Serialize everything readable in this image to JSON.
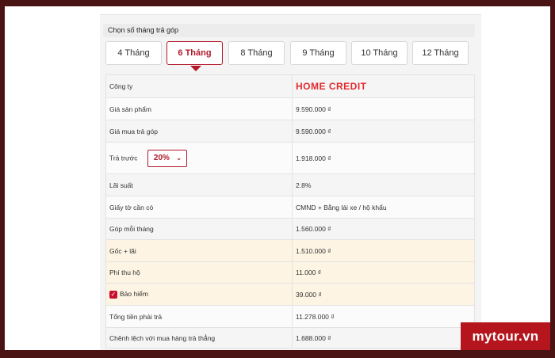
{
  "section_title": "Chọn số tháng trả góp",
  "tabs": [
    {
      "label": "4 Tháng",
      "active": false
    },
    {
      "label": "6 Tháng",
      "active": true
    },
    {
      "label": "8 Tháng",
      "active": false
    },
    {
      "label": "9 Tháng",
      "active": false
    },
    {
      "label": "10 Tháng",
      "active": false
    },
    {
      "label": "12 Tháng",
      "active": false
    }
  ],
  "rows": {
    "company": {
      "label": "Công ty",
      "value": "HOME CREDIT"
    },
    "product_price": {
      "label": "Giá sản phẩm",
      "value": "9.590.000 ₫"
    },
    "installment_price": {
      "label": "Giá mua trả góp",
      "value": "9.590.000 ₫"
    },
    "down_payment": {
      "label": "Trả trước",
      "select_value": "20%",
      "value": "1.918.000 ₫"
    },
    "interest": {
      "label": "Lãi suất",
      "value": "2.8%"
    },
    "documents": {
      "label": "Giấy tờ cần có",
      "value": "CMND + Bằng lái xe / hộ khẩu"
    },
    "monthly": {
      "label": "Góp mỗi tháng",
      "value": "1.560.000 ₫"
    },
    "principal_interest": {
      "label": "Gốc + lãi",
      "value": "1.510.000 ₫"
    },
    "collection_fee": {
      "label": "Phí thu hộ",
      "value": "11.000 ₫"
    },
    "insurance": {
      "label": "Bảo hiểm",
      "checked": true,
      "value": "39.000 ₫"
    },
    "total": {
      "label": "Tổng tiền phải trả",
      "value": "11.278.000 ₫"
    },
    "difference": {
      "label": "Chênh lệch với mua hàng trả thẳng",
      "value": "1.688.000 ₫"
    }
  },
  "watermark": "mytour.vn",
  "colors": {
    "accent": "#b3192b",
    "frame": "#4a1414",
    "highlight_row": "#fdf4e3"
  }
}
